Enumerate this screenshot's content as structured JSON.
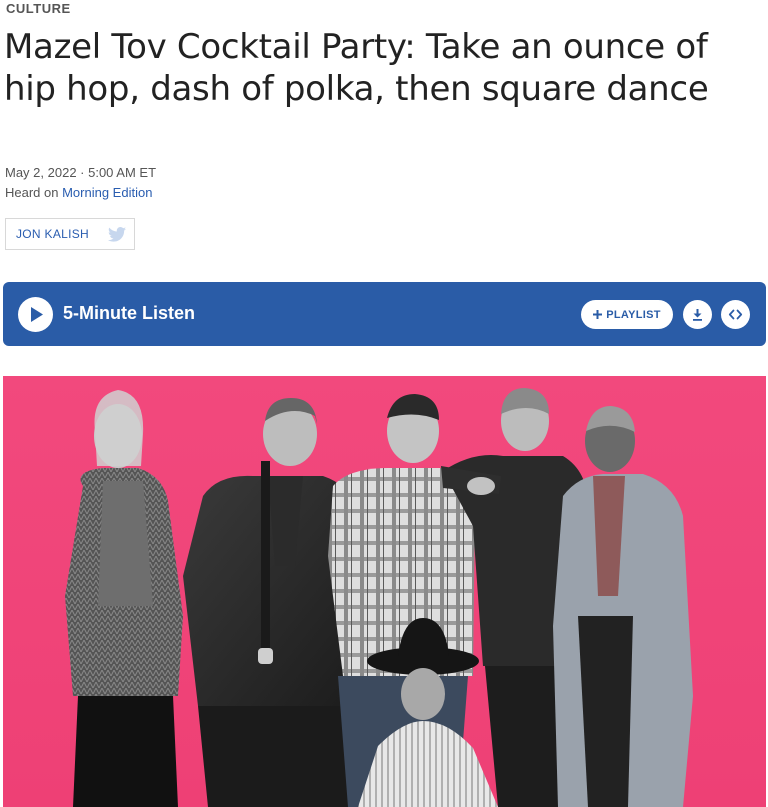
{
  "section": "CULTURE",
  "headline": "Mazel Tov Cocktail Party: Take an ounce of hip hop, dash of polka, then square dance",
  "dateline": "May 2, 2022 · 5:00 AM ET",
  "heard_on": {
    "prefix": "Heard on ",
    "program": "Morning Edition"
  },
  "byline": {
    "name": "JON KALISH",
    "social_icon": "twitter-icon"
  },
  "player": {
    "listen_label": "5-Minute Listen",
    "playlist_label": "PLAYLIST",
    "icons": [
      "play-icon",
      "plus-icon",
      "download-icon",
      "embed-icon"
    ],
    "background_color": "#2a5ca7"
  },
  "photo": {
    "background_color": "#f0457a"
  }
}
